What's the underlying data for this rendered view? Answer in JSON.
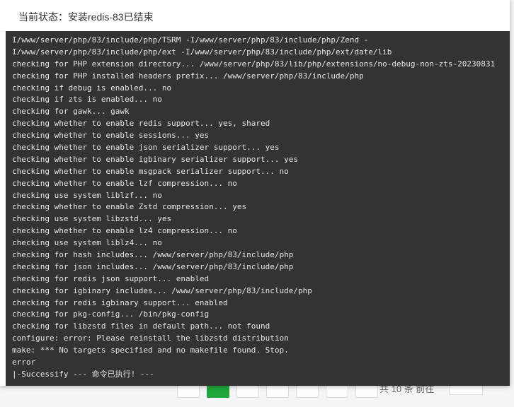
{
  "dialog": {
    "title": "当前状态：安装redis-83已结束"
  },
  "terminal": {
    "lines": [
      "I/www/server/php/83/include/php/TSRM -I/www/server/php/83/include/php/Zend -",
      "I/www/server/php/83/include/php/ext -I/www/server/php/83/include/php/ext/date/lib",
      "checking for PHP extension directory... /www/server/php/83/lib/php/extensions/no-debug-non-zts-20230831",
      "checking for PHP installed headers prefix... /www/server/php/83/include/php",
      "checking if debug is enabled... no",
      "checking if zts is enabled... no",
      "checking for gawk... gawk",
      "checking whether to enable redis support... yes, shared",
      "checking whether to enable sessions... yes",
      "checking whether to enable json serializer support... yes",
      "checking whether to enable igbinary serializer support... yes",
      "checking whether to enable msgpack serializer support... no",
      "checking whether to enable lzf compression... no",
      "checking use system liblzf... no",
      "checking whether to enable Zstd compression... yes",
      "checking use system libzstd... yes",
      "checking whether to enable lz4 compression... no",
      "checking use system liblz4... no",
      "checking for hash includes... /www/server/php/83/include/php",
      "checking for json includes... /www/server/php/83/include/php",
      "checking for redis json support... enabled",
      "checking for igbinary includes... /www/server/php/83/include/php",
      "checking for redis igbinary support... enabled",
      "checking for pkg-config... /bin/pkg-config",
      "checking for libzstd files in default path... not found",
      "configure: error: Please reinstall the libzstd distribution",
      "make: *** No targets specified and no makefile found. Stop.",
      "error",
      "|-Successify --- 命令已执行! ---"
    ]
  },
  "background": {
    "pagination_text": "共 10 条  前往"
  }
}
